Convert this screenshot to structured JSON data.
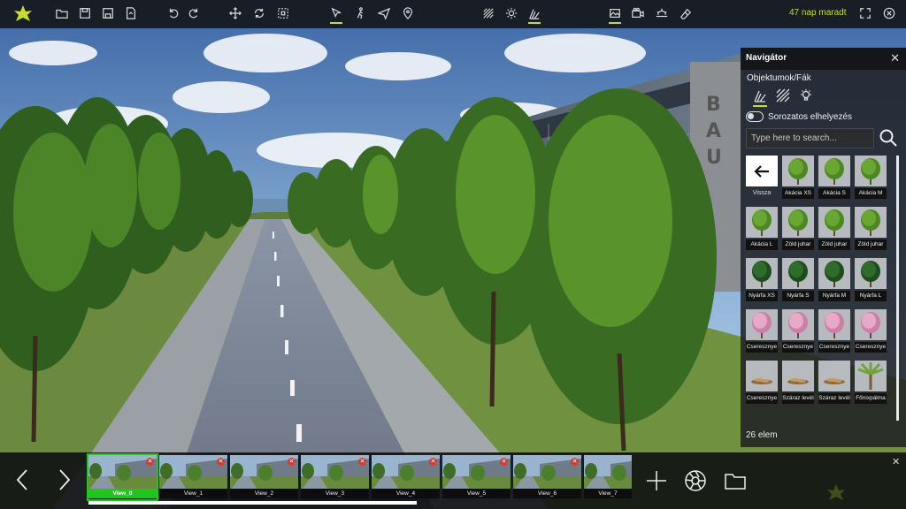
{
  "toolbar": {
    "logo": "leaf-logo",
    "left_icons": [
      "folder-open-icon",
      "save-icon",
      "save-as-icon",
      "export-icon",
      "undo-icon",
      "redo-icon",
      "move-icon",
      "rotate-icon",
      "scale-icon"
    ],
    "mode_icons": [
      "pointer-icon",
      "walk-icon",
      "fly-icon",
      "location-pin-icon"
    ],
    "active_modes": [
      "pointer-icon",
      "grass-paint-icon",
      "tree-paint-icon",
      "image-camera-icon"
    ],
    "right_icons": [
      "grass-paint-icon",
      "sun-settings-icon",
      "tree-paint-icon",
      "image-camera-icon",
      "video-camera-icon",
      "sunset-icon",
      "eraser-icon"
    ],
    "days_left": "47 nap maradt",
    "fullscreen_icon": "fullscreen-icon",
    "close_icon": "close-icon",
    "accent_color": "#c8dc28"
  },
  "navigator": {
    "title": "Navigátor",
    "breadcrumb": "Objektumok/Fák",
    "category_tabs": [
      "tree-category-icon",
      "hatch-category-icon",
      "light-category-icon"
    ],
    "toggle_label": "Sorozatos elhelyezés",
    "search_placeholder": "Type here to search...",
    "back_label": "Vissza",
    "items": [
      {
        "label": "Akácia XS",
        "kind": "tree"
      },
      {
        "label": "Akácia S",
        "kind": "tree"
      },
      {
        "label": "Akácia M",
        "kind": "tree"
      },
      {
        "label": "Akácia L",
        "kind": "tree"
      },
      {
        "label": "Zöld juhar",
        "kind": "tree"
      },
      {
        "label": "Zöld juhar",
        "kind": "tree"
      },
      {
        "label": "Zöld juhar",
        "kind": "tree"
      },
      {
        "label": "Nyárfa XS",
        "kind": "dark"
      },
      {
        "label": "Nyárfa S",
        "kind": "dark"
      },
      {
        "label": "Nyárfa M",
        "kind": "dark"
      },
      {
        "label": "Nyárfa L",
        "kind": "dark"
      },
      {
        "label": "Cseresznye",
        "kind": "pink"
      },
      {
        "label": "Cseresznye",
        "kind": "pink"
      },
      {
        "label": "Cseresznye",
        "kind": "pink"
      },
      {
        "label": "Cseresznye",
        "kind": "pink"
      },
      {
        "label": "Cseresznye",
        "kind": "leaves"
      },
      {
        "label": "Száraz levél",
        "kind": "leaves"
      },
      {
        "label": "Száraz levél",
        "kind": "leaves"
      },
      {
        "label": "Főnixpálma",
        "kind": "palm"
      }
    ],
    "count_label": "26 elem"
  },
  "views": {
    "items": [
      {
        "label": "View_0",
        "active": true
      },
      {
        "label": "View_1",
        "active": false
      },
      {
        "label": "View_2",
        "active": false
      },
      {
        "label": "View_3",
        "active": false
      },
      {
        "label": "View_4",
        "active": false
      },
      {
        "label": "View_5",
        "active": false
      },
      {
        "label": "View_6",
        "active": false
      },
      {
        "label": "View_7",
        "active": false
      }
    ],
    "prev_icon": "chevron-left-icon",
    "next_icon": "chevron-right-icon",
    "actions": [
      "add-view-icon",
      "render-aperture-icon",
      "folder-icon"
    ],
    "active_color": "#22c41e"
  }
}
